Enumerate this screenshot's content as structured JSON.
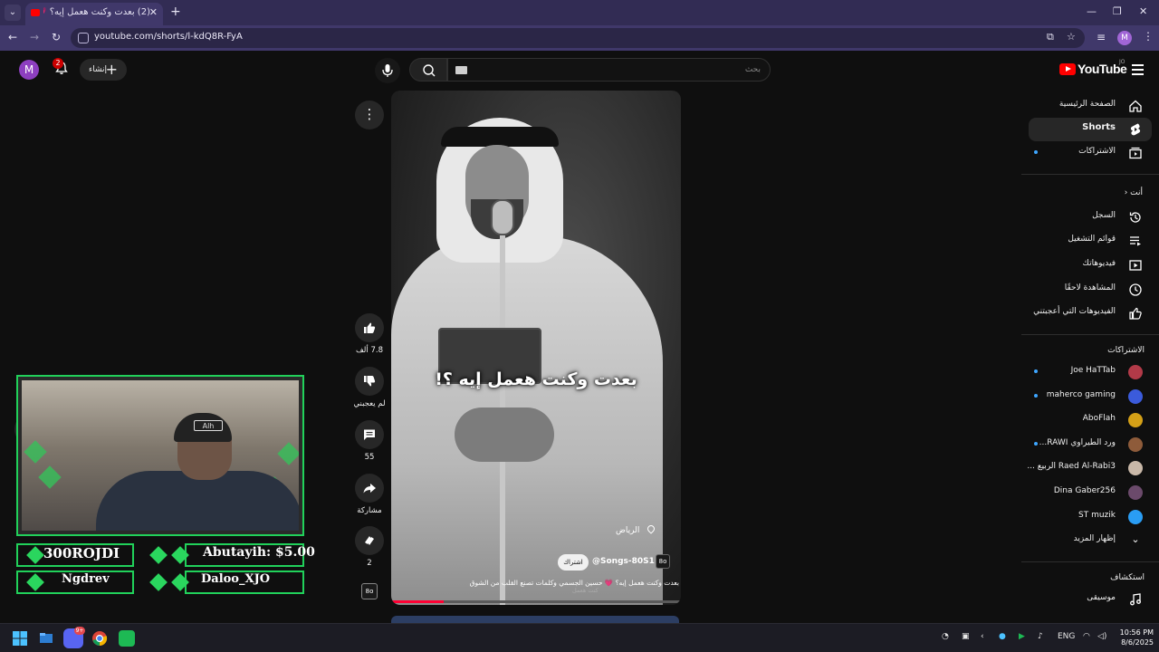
{
  "browser": {
    "tab_title": "(2) بعدت وكنت هعمل إيه؟ 💗",
    "url": "youtube.com/shorts/l-kdQ8R-FyA",
    "profile_initial": "M"
  },
  "header": {
    "avatar_initial": "M",
    "notifications_count": "2",
    "create_label": "إنشاء",
    "search_placeholder": "بحث",
    "logo_text": "YouTube",
    "country_code": "JO"
  },
  "player": {
    "caption": "بعدت وكنت هعمل إيه ؟!",
    "location": "الرياض",
    "channel": "@Songs-80S1",
    "channel_badge": "8o",
    "subscribe_label": "اشتراك",
    "video_title": "بعدت وكنت هعمل إيه؟ 💗 حسين الجسمي وكلمات تصنع القلب من الشوق",
    "video_sub": "كنت هعمل",
    "progress_fraction": 0.18
  },
  "actions": {
    "likes": "7.8 ألف",
    "dislike_label": "لم يعجبني",
    "comments": "55",
    "share_label": "مشاركة",
    "remix_count": "2",
    "sound_badge": "8o"
  },
  "sidebar": {
    "main": [
      {
        "label": "الصفحة الرئيسية"
      },
      {
        "label": "Shorts"
      },
      {
        "label": "الاشتراكات"
      }
    ],
    "you_header": "أنت",
    "you": [
      {
        "label": "السجل"
      },
      {
        "label": "قوائم التشغيل"
      },
      {
        "label": "فيديوهاتك"
      },
      {
        "label": "المشاهدة لاحقًا"
      },
      {
        "label": "الفيديوهات التي أعجبتني"
      }
    ],
    "subs_header": "الاشتراكات",
    "subs": [
      {
        "label": "Joe HaTTab",
        "color": "#b23a48"
      },
      {
        "label": "maherco gaming",
        "color": "#3b5bdb"
      },
      {
        "label": "AboFlah",
        "color": "#d4a017"
      },
      {
        "label": "ورد الطيراوي RAWI...",
        "color": "#8e5b3a"
      },
      {
        "label": "Raed Al-Rabi3 الربيع ...",
        "color": "#c9b8a8"
      },
      {
        "label": "Dina Gaber256",
        "color": "#6b4a6b"
      },
      {
        "label": "ST muzik",
        "color": "#2a9df4"
      },
      {
        "label": "إظهار المزيد",
        "color": ""
      }
    ],
    "explore_header": "استكشاف",
    "explore": [
      {
        "label": "موسيقى"
      }
    ]
  },
  "overlay": {
    "row1_left": "300ROJDI",
    "row1_right": "Abutayih: $5.00",
    "row2_left": "Ngdrev",
    "row2_right": "Daloo_XJO",
    "cap_logo": "Alh"
  },
  "taskbar": {
    "lang": "ENG",
    "time": "10:56 PM",
    "date": "8/6/2025",
    "discord_badge": "9+"
  }
}
